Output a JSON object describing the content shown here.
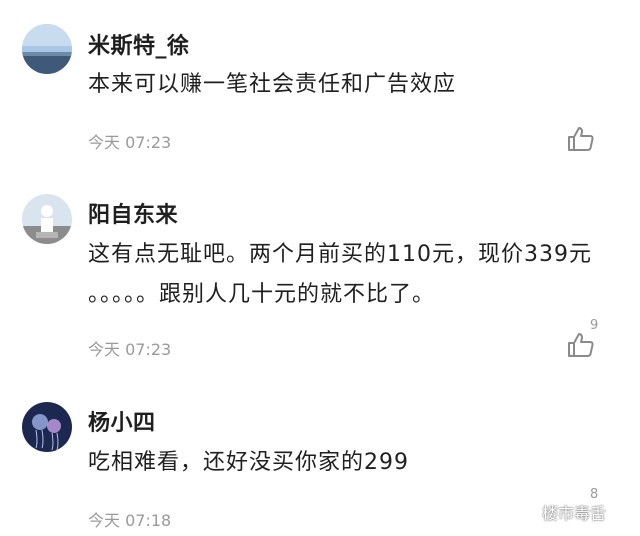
{
  "comments": [
    {
      "username": "米斯特_徐",
      "lines": [
        "本来可以赚一笔社会责任和广告效应"
      ],
      "time": "今天 07:23",
      "likes": "",
      "avatar": "landscape-avatar"
    },
    {
      "username": "阳自东来",
      "lines": [
        "这有点无耻吧。两个月前买的110元，现价339元",
        "。。。。。跟别人几十元的就不比了。"
      ],
      "time": "今天 07:23",
      "likes": "9",
      "avatar": "statue-avatar"
    },
    {
      "username": "杨小四",
      "lines": [
        "吃相难看，还好没买你家的299"
      ],
      "time": "今天 07:18",
      "likes": "8",
      "avatar": "jellyfish-avatar"
    }
  ],
  "icons": {
    "like": "thumbs-up-icon"
  },
  "watermark": {
    "text": "楼市毒舌"
  },
  "colors": {
    "text": "#1f1f1f",
    "meta": "#9a9a9a",
    "background": "#ffffff"
  }
}
